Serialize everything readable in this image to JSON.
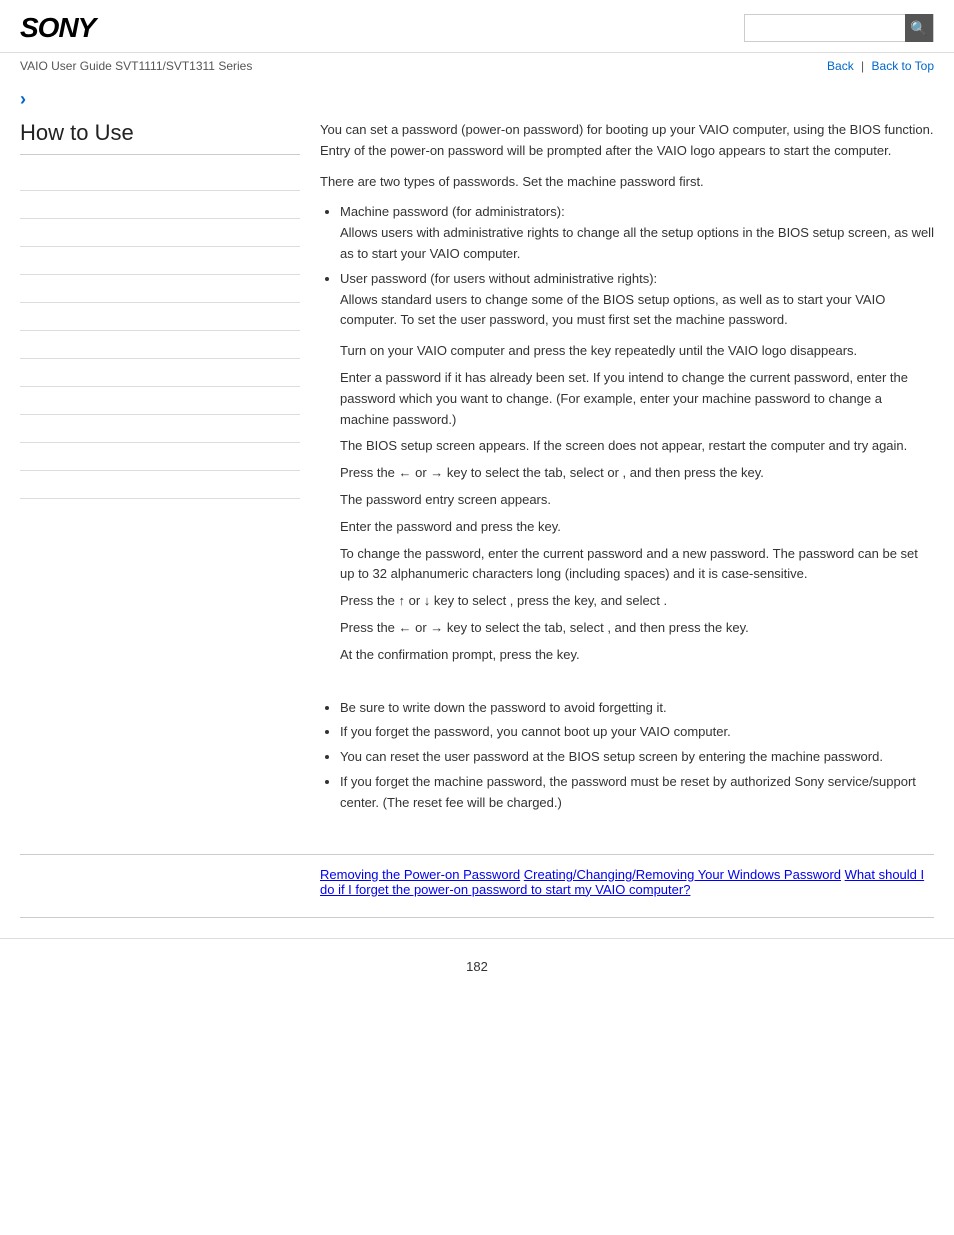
{
  "header": {
    "logo": "SONY",
    "search_placeholder": "",
    "search_icon": "🔍"
  },
  "nav": {
    "guide_text": "VAIO User Guide SVT1111/SVT1311 Series",
    "back_label": "Back",
    "back_to_top_label": "Back to Top"
  },
  "sidebar": {
    "title": "How to Use",
    "items": [
      {
        "label": ""
      },
      {
        "label": ""
      },
      {
        "label": ""
      },
      {
        "label": ""
      },
      {
        "label": ""
      },
      {
        "label": ""
      },
      {
        "label": ""
      },
      {
        "label": ""
      },
      {
        "label": ""
      },
      {
        "label": ""
      },
      {
        "label": ""
      },
      {
        "label": ""
      }
    ]
  },
  "content": {
    "para1": "You can set a password (power-on password) for booting up your VAIO computer, using the BIOS function. Entry of the power-on password will be prompted after the VAIO logo appears to start the computer.",
    "para2": "There are two types of passwords. Set the machine password first.",
    "bullet1_title": "Machine password (for administrators):",
    "bullet1_body": "Allows users with administrative rights to change all the setup options in the BIOS setup screen, as well as to start your VAIO computer.",
    "bullet2_title": "User password (for users without administrative rights):",
    "bullet2_body": "Allows standard users to change some of the BIOS setup options, as well as to start your VAIO computer. To set the user password, you must first set the machine password.",
    "step1": "Turn on your VAIO computer and press the      key repeatedly until the VAIO logo disappears.",
    "step2": "Enter a password if it has already been set. If you intend to change the current password, enter the password which you want to change. (For example, enter your machine password to change a machine password.)",
    "step3": "The BIOS setup screen appears. If the screen does not appear, restart the computer and try again.",
    "step4": "Press the ← or → key to select the                tab, select or                     , and then press the         key.",
    "step4b": "The password entry screen appears.",
    "step5": "Enter the password and press the        key.",
    "step5b": "To change the password, enter the current password and a new password. The password can be set up to 32 alphanumeric characters long (including spaces) and it is case-sensitive.",
    "step6": "Press the ↑ or ↓ key to select                          , press the        key, and select        .",
    "step7": "Press the ← or → key to select the        tab, select           , and then press the        key.",
    "step8": "At the confirmation prompt, press the        key.",
    "notes_title": "",
    "note1": "Be sure to write down the password to avoid forgetting it.",
    "note2": "If you forget the password, you cannot boot up your VAIO computer.",
    "note3": "You can reset the user password at the BIOS setup screen by entering the machine password.",
    "note4": "If you forget the machine password, the password must be reset by authorized Sony service/support center. (The reset fee will be charged.)"
  },
  "footer_links": {
    "link1": "Removing the Power-on Password",
    "link2": "Creating/Changing/Removing Your Windows Password",
    "link3": "What should I do if I forget the power-on password to start my VAIO computer?"
  },
  "page_number": "182"
}
